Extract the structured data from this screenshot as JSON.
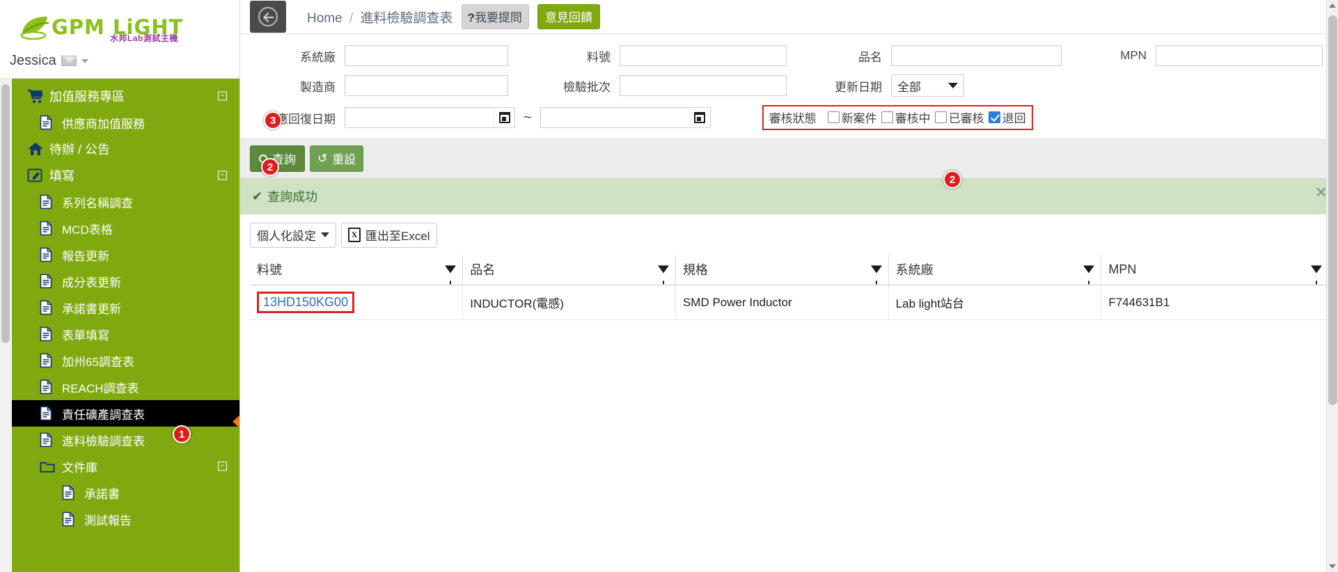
{
  "brand": {
    "name": "GPM LiGHT",
    "subtitle": "水邦Lab測試主機",
    "user": "Jessica"
  },
  "sidebar": {
    "items": [
      {
        "label": "加值服務專區",
        "icon": "cart-icon",
        "level": 0,
        "active": false,
        "toggle": "−"
      },
      {
        "label": "供應商加值服務",
        "icon": "document-icon",
        "level": 1,
        "active": false,
        "toggle": ""
      },
      {
        "label": "待辦 / 公告",
        "icon": "home-icon",
        "level": 0,
        "active": false,
        "toggle": ""
      },
      {
        "label": "填寫",
        "icon": "pencil-square-icon",
        "level": 0,
        "active": false,
        "toggle": "−"
      },
      {
        "label": "系列名稱調查",
        "icon": "document-icon",
        "level": 1,
        "active": false,
        "toggle": ""
      },
      {
        "label": "MCD表格",
        "icon": "document-icon",
        "level": 1,
        "active": false,
        "toggle": ""
      },
      {
        "label": "報告更新",
        "icon": "document-icon",
        "level": 1,
        "active": false,
        "toggle": ""
      },
      {
        "label": "成分表更新",
        "icon": "document-icon",
        "level": 1,
        "active": false,
        "toggle": ""
      },
      {
        "label": "承諾書更新",
        "icon": "document-icon",
        "level": 1,
        "active": false,
        "toggle": ""
      },
      {
        "label": "表單填寫",
        "icon": "document-icon",
        "level": 1,
        "active": false,
        "toggle": ""
      },
      {
        "label": "加州65調查表",
        "icon": "document-icon",
        "level": 1,
        "active": false,
        "toggle": ""
      },
      {
        "label": "REACH調查表",
        "icon": "document-icon",
        "level": 1,
        "active": false,
        "toggle": ""
      },
      {
        "label": "責任礦產調查表",
        "icon": "document-icon",
        "level": 1,
        "active": true,
        "toggle": ""
      },
      {
        "label": "進料檢驗調查表",
        "icon": "document-icon",
        "level": 1,
        "active": false,
        "toggle": ""
      },
      {
        "label": "文件庫",
        "icon": "folder-icon",
        "level": 1,
        "active": false,
        "toggle": "−"
      },
      {
        "label": "承諾書",
        "icon": "document-icon",
        "level": 2,
        "active": false,
        "toggle": ""
      },
      {
        "label": "測試報告",
        "icon": "document-icon",
        "level": 2,
        "active": false,
        "toggle": ""
      }
    ]
  },
  "topbar": {
    "breadcrumb_home": "Home",
    "breadcrumb_sep": "/",
    "breadcrumb_current": "進料檢驗調查表",
    "ask_button": "我要提問",
    "ask_button_mark": "?",
    "feedback_button": "意見回饋"
  },
  "search_form": {
    "fields": [
      {
        "label": "系統廠",
        "value": "",
        "placeholder": ""
      },
      {
        "label": "料號",
        "value": "",
        "placeholder": ""
      },
      {
        "label": "品名",
        "value": "",
        "placeholder": ""
      },
      {
        "label": "MPN",
        "value": "",
        "placeholder": ""
      },
      {
        "label": "製造商",
        "value": "",
        "placeholder": ""
      },
      {
        "label": "檢驗批次",
        "value": "",
        "placeholder": ""
      }
    ],
    "update_date_label": "更新日期",
    "update_date_value": "全部",
    "reply_date_label": "應回復日期",
    "reply_date_from": "",
    "reply_date_to": "",
    "date_range_sep": "~",
    "review_status_label": "審核狀態",
    "review_status_options": [
      {
        "label": "新案件",
        "checked": false
      },
      {
        "label": "審核中",
        "checked": false
      },
      {
        "label": "已審核",
        "checked": false
      },
      {
        "label": "退回",
        "checked": true
      }
    ]
  },
  "action_bar": {
    "search_button": "查詢",
    "reset_button": "重設"
  },
  "alert": {
    "text": "查詢成功",
    "check_glyph": "✔",
    "close_glyph": "✕"
  },
  "grid_toolbar": {
    "personalize_button": "個人化設定",
    "export_button": "匯出至Excel",
    "export_icon_letter": "X"
  },
  "grid": {
    "columns": [
      "料號",
      "品名",
      "規格",
      "系統廠",
      "MPN"
    ],
    "rows": [
      {
        "料號": "13HD150KG00",
        "品名": "INDUCTOR(電感)",
        "規格": "SMD Power Inductor",
        "系統廠": "Lab light站台",
        "MPN": "F744631B1"
      }
    ]
  },
  "annotations": {
    "badge1": "1",
    "badge2a": "2",
    "badge2b": "2",
    "badge3": "3"
  },
  "colors": {
    "sidebar_green": "#7fa90f",
    "brand_green": "#8ac11a",
    "accent_red": "#e02020",
    "link_blue": "#2f6fba",
    "alert_green_bg": "#cfe3c4"
  }
}
